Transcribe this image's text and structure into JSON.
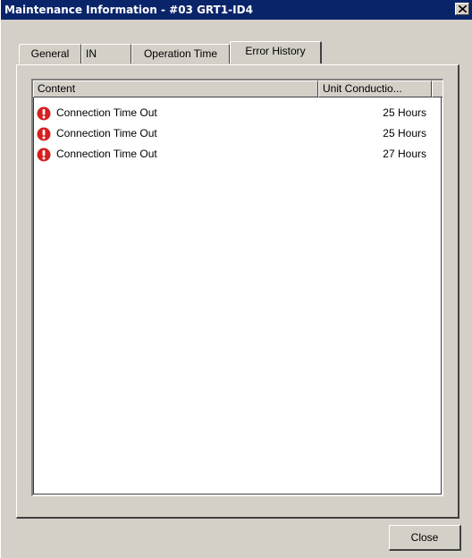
{
  "window": {
    "title": "Maintenance Information - #03 GRT1-ID4",
    "close_glyph": "×"
  },
  "tabs": [
    {
      "label": "General",
      "active": false
    },
    {
      "label": "IN",
      "active": false
    },
    {
      "label": "Operation Time",
      "active": false
    },
    {
      "label": "Error History",
      "active": true
    }
  ],
  "list": {
    "columns": [
      "Content",
      "Unit Conductio..."
    ],
    "rows": [
      {
        "content": "Connection Time Out",
        "hours": "25 Hours",
        "icon": "error-icon"
      },
      {
        "content": "Connection Time Out",
        "hours": "25 Hours",
        "icon": "error-icon"
      },
      {
        "content": "Connection Time Out",
        "hours": "27 Hours",
        "icon": "error-icon"
      }
    ]
  },
  "buttons": {
    "close_label": "Close"
  },
  "colors": {
    "titlebar": "#0a246a",
    "face": "#d4d0c8",
    "error_red": "#d42020"
  }
}
